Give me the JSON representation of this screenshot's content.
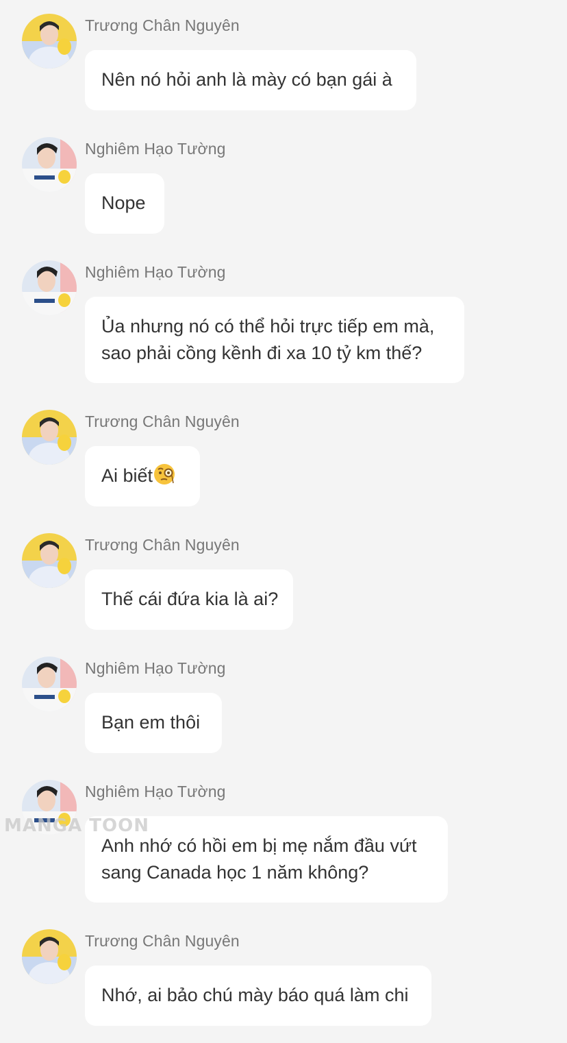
{
  "watermark": "MANGA TOON",
  "messages": [
    {
      "sender": "Trương Chân Nguyên",
      "lines": [
        "Nên nó hỏi anh là mày có bạn gái à"
      ]
    },
    {
      "sender": "Nghiêm Hạo Tường",
      "lines": [
        "Nope"
      ]
    },
    {
      "sender": "Nghiêm Hạo Tường",
      "lines": [
        "Ủa nhưng nó có thể hỏi trực tiếp em mà,",
        "sao phải cồng kềnh đi xa 10 tỷ km thế?"
      ]
    },
    {
      "sender": "Trương Chân Nguyên",
      "lines": [
        "Ai biết"
      ],
      "emoji": "monocle-face-emoji"
    },
    {
      "sender": "Trương Chân Nguyên",
      "lines": [
        "Thế cái đứa kia là ai?"
      ]
    },
    {
      "sender": "Nghiêm Hạo Tường",
      "lines": [
        "Bạn em thôi"
      ]
    },
    {
      "sender": "Nghiêm Hạo Tường",
      "lines": [
        "Anh nhớ có hồi em bị mẹ nắm đầu vứt",
        "sang Canada học 1 năm không?"
      ]
    },
    {
      "sender": "Trương Chân Nguyên",
      "lines": [
        "Nhớ, ai bảo chú mày báo quá làm chi"
      ]
    }
  ]
}
